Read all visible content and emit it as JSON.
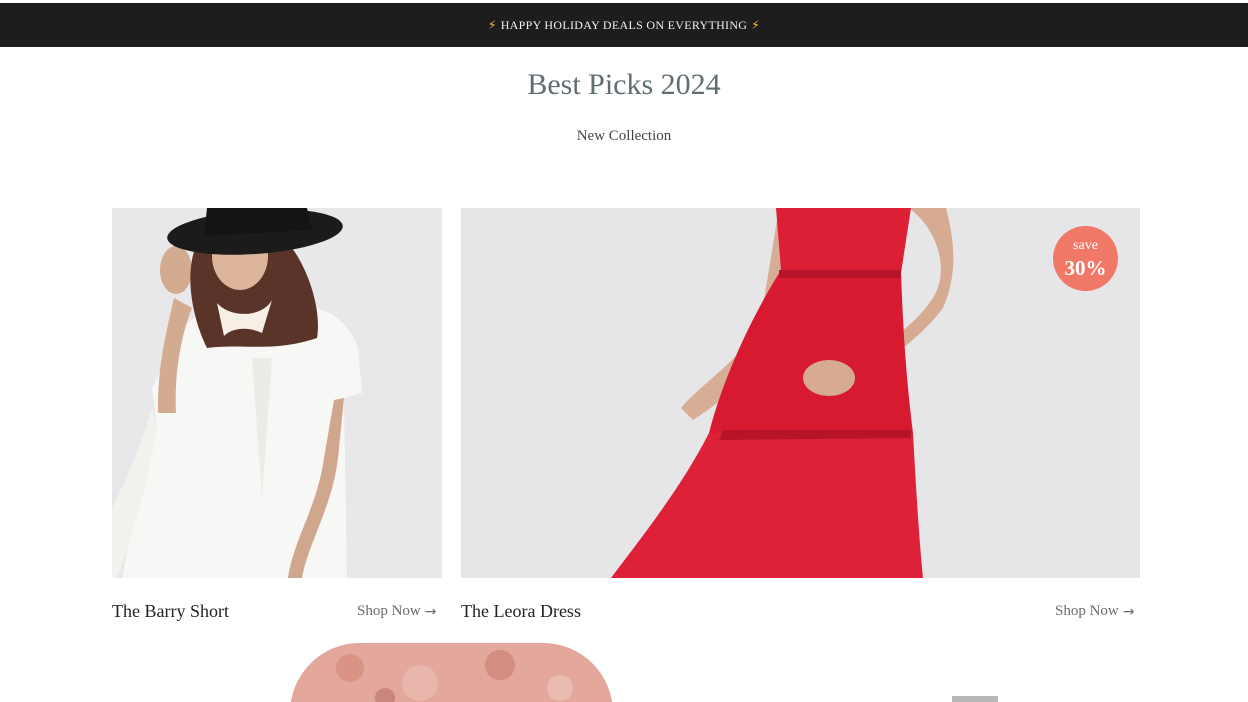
{
  "announcement": {
    "text": "HAPPY HOLIDAY DEALS ON EVERYTHING",
    "icon": "lightning-bolt-icon",
    "background": "#1d1d1d"
  },
  "section": {
    "title": "Best Picks 2024",
    "subtitle": "New Collection"
  },
  "products": [
    {
      "name": "The Barry Short",
      "cta": "Shop Now",
      "cta_icon": "arrow-right-icon"
    },
    {
      "name": "The Leora Dress",
      "cta": "Shop Now",
      "cta_icon": "arrow-right-icon",
      "badge": {
        "top": "save",
        "bottom": "30%",
        "color": "#f07866"
      }
    }
  ],
  "colors": {
    "title": "#5f6e73",
    "badge": "#f07866",
    "dress": "#dc1f35"
  }
}
